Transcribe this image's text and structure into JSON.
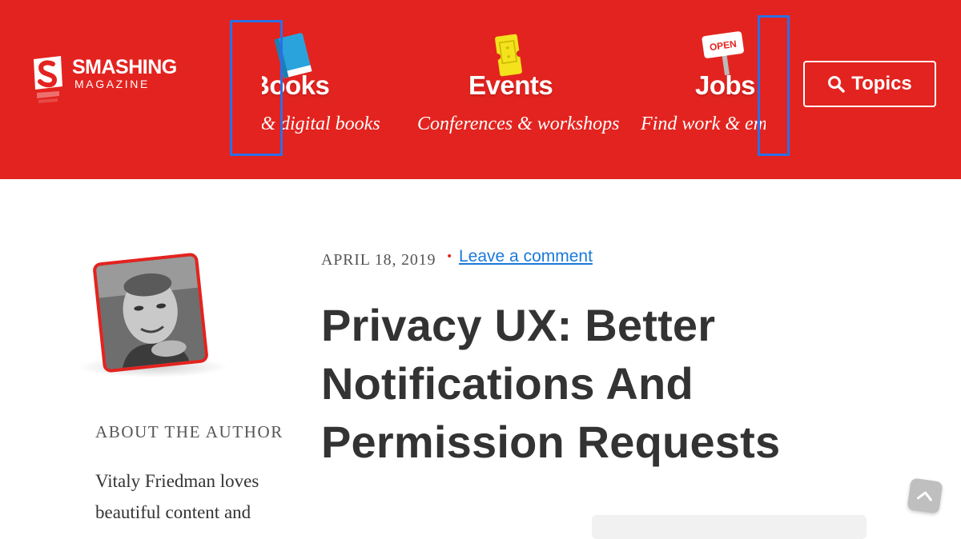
{
  "header": {
    "logo": {
      "title": "SMASHING",
      "subtitle": "MAGAZINE"
    },
    "nav": [
      {
        "title": "Books",
        "subtitle": "Print & digital books",
        "icon": "book-icon"
      },
      {
        "title": "Events",
        "subtitle": "Conferences & workshops",
        "icon": "ticket-icon"
      },
      {
        "title": "Jobs",
        "subtitle": "Find work & employees",
        "icon": "open-sign-icon",
        "icon_text": "OPEN"
      }
    ],
    "topics_label": "Topics"
  },
  "article": {
    "date": "APRIL 18, 2019",
    "separator": "•",
    "comment_link": "Leave a comment",
    "title": "Privacy UX: Better Notifications And Permission Requests"
  },
  "author": {
    "about_heading": "ABOUT THE AUTHOR",
    "bio": "Vitaly Friedman loves beautiful content and"
  },
  "colors": {
    "brand": "#e3231f",
    "link": "#1a7ad9",
    "highlight": "#2c6fe6"
  }
}
